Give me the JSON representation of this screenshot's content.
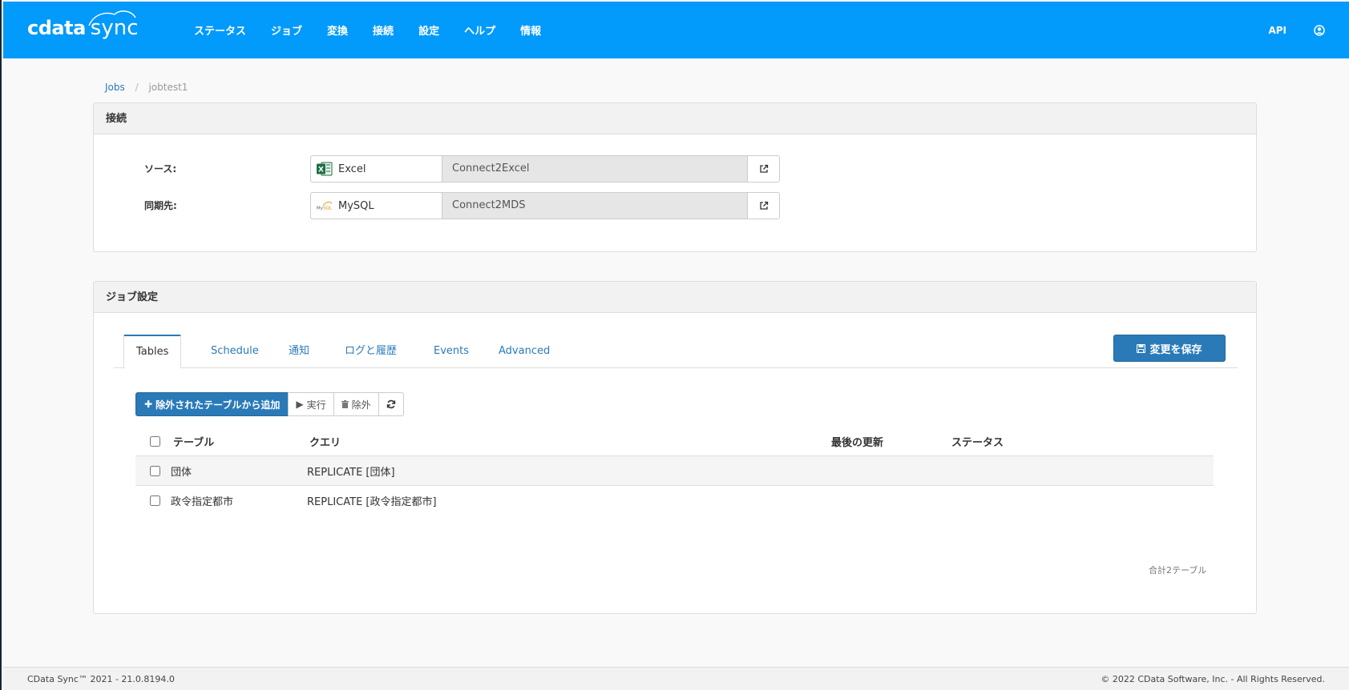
{
  "header": {
    "logo_brand": "cdata",
    "logo_product": "sync",
    "nav": [
      "ステータス",
      "ジョブ",
      "変換",
      "接続",
      "設定",
      "ヘルプ",
      "情報"
    ],
    "api_label": "API",
    "bg_color": "#029afb"
  },
  "breadcrumb": {
    "root": "Jobs",
    "separator": "/",
    "current": "jobtest1"
  },
  "connections_panel": {
    "title": "接続",
    "source": {
      "label": "ソース:",
      "type": "Excel",
      "type_icon": "excel-icon",
      "name": "Connect2Excel"
    },
    "destination": {
      "label": "同期先:",
      "type": "MySQL",
      "type_icon": "mysql-icon",
      "name": "Connect2MDS"
    }
  },
  "job_panel": {
    "title": "ジョブ設定",
    "tabs": [
      "Tables",
      "Schedule",
      "通知",
      "ログと履歴",
      "Events",
      "Advanced"
    ],
    "active_tab": "Tables",
    "save_button": "変更を保存",
    "toolbar": {
      "add_excluded": "除外されたテーブルから追加",
      "run": "実行",
      "exclude": "除外"
    },
    "table": {
      "columns": [
        "テーブル",
        "クエリ",
        "最後の更新",
        "ステータス"
      ],
      "rows": [
        {
          "table": "団体",
          "query": "REPLICATE [団体]",
          "last_updated": "",
          "status": ""
        },
        {
          "table": "政令指定都市",
          "query": "REPLICATE [政令指定都市]",
          "last_updated": "",
          "status": ""
        }
      ]
    },
    "total": "合計2テーブル"
  },
  "footer": {
    "version": "CData Sync™ 2021 - 21.0.8194.0",
    "copyright": "© 2022 CData Software, Inc. - All Rights Reserved."
  },
  "colors": {
    "primary_button": "#2a7ab8",
    "link": "#2a7ab8"
  }
}
